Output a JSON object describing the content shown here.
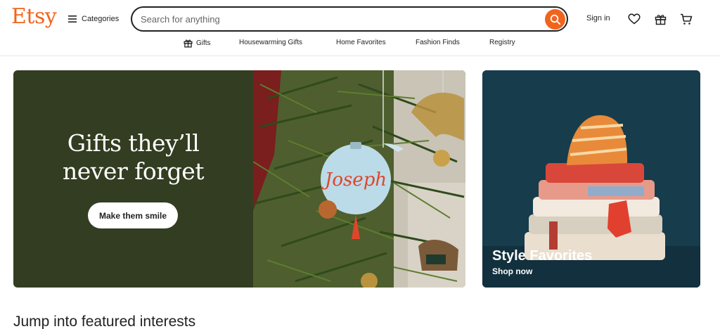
{
  "header": {
    "logo": "Etsy",
    "categories_label": "Categories",
    "search": {
      "placeholder": "Search for anything"
    },
    "signin_label": "Sign in",
    "icons": [
      "heart-icon",
      "gift-icon",
      "cart-icon"
    ]
  },
  "nav": {
    "items": [
      {
        "label": "Gifts",
        "icon": "gift-icon"
      },
      {
        "label": "Housewarming Gifts"
      },
      {
        "label": "Home Favorites"
      },
      {
        "label": "Fashion Finds"
      },
      {
        "label": "Registry"
      }
    ]
  },
  "hero": {
    "title_line1": "Gifts they’ll",
    "title_line2": "never forget",
    "button_label": "Make them smile",
    "ornament_text": "Joseph",
    "background_color": "#333d21"
  },
  "side_banner": {
    "title": "Style Favorites",
    "subtitle": "Shop now",
    "background_color": "#173c4c"
  },
  "featured": {
    "title": "Jump into featured interests"
  },
  "colors": {
    "brand": "#F1641E",
    "text": "#222222"
  }
}
